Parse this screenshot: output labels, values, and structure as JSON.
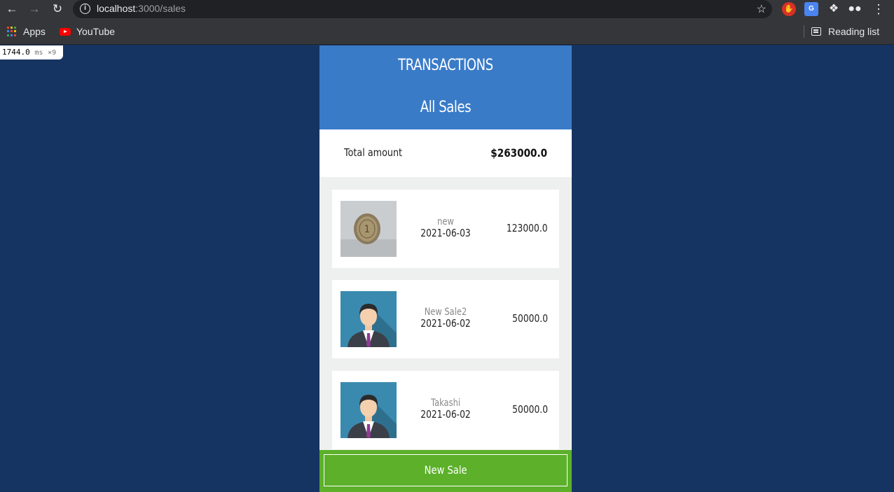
{
  "browser": {
    "url_host": "localhost",
    "url_path": ":3000/sales",
    "bookmarks": [
      {
        "label": "Apps",
        "icon": "apps-grid-icon"
      },
      {
        "label": "YouTube",
        "icon": "youtube-icon"
      }
    ],
    "reading_list_label": "Reading list"
  },
  "perf_overlay": {
    "value": "1744.0",
    "unit": "ms",
    "count": "×9"
  },
  "app": {
    "title": "TRANSACTIONS",
    "subtitle": "All Sales",
    "total_label": "Total amount",
    "total_value": "$263000.0",
    "transactions": [
      {
        "name": "new",
        "date": "2021-06-03",
        "amount": "123000.0",
        "image": "coin-photo"
      },
      {
        "name": "New Sale2",
        "date": "2021-06-02",
        "amount": "50000.0",
        "image": "businessman-avatar"
      },
      {
        "name": "Takashi",
        "date": "2021-06-02",
        "amount": "50000.0",
        "image": "businessman-avatar"
      }
    ],
    "new_sale_label": "New Sale"
  },
  "colors": {
    "page_bg": "#163461",
    "header_bg": "#3a7bc8",
    "button_bg": "#5cb02a"
  }
}
